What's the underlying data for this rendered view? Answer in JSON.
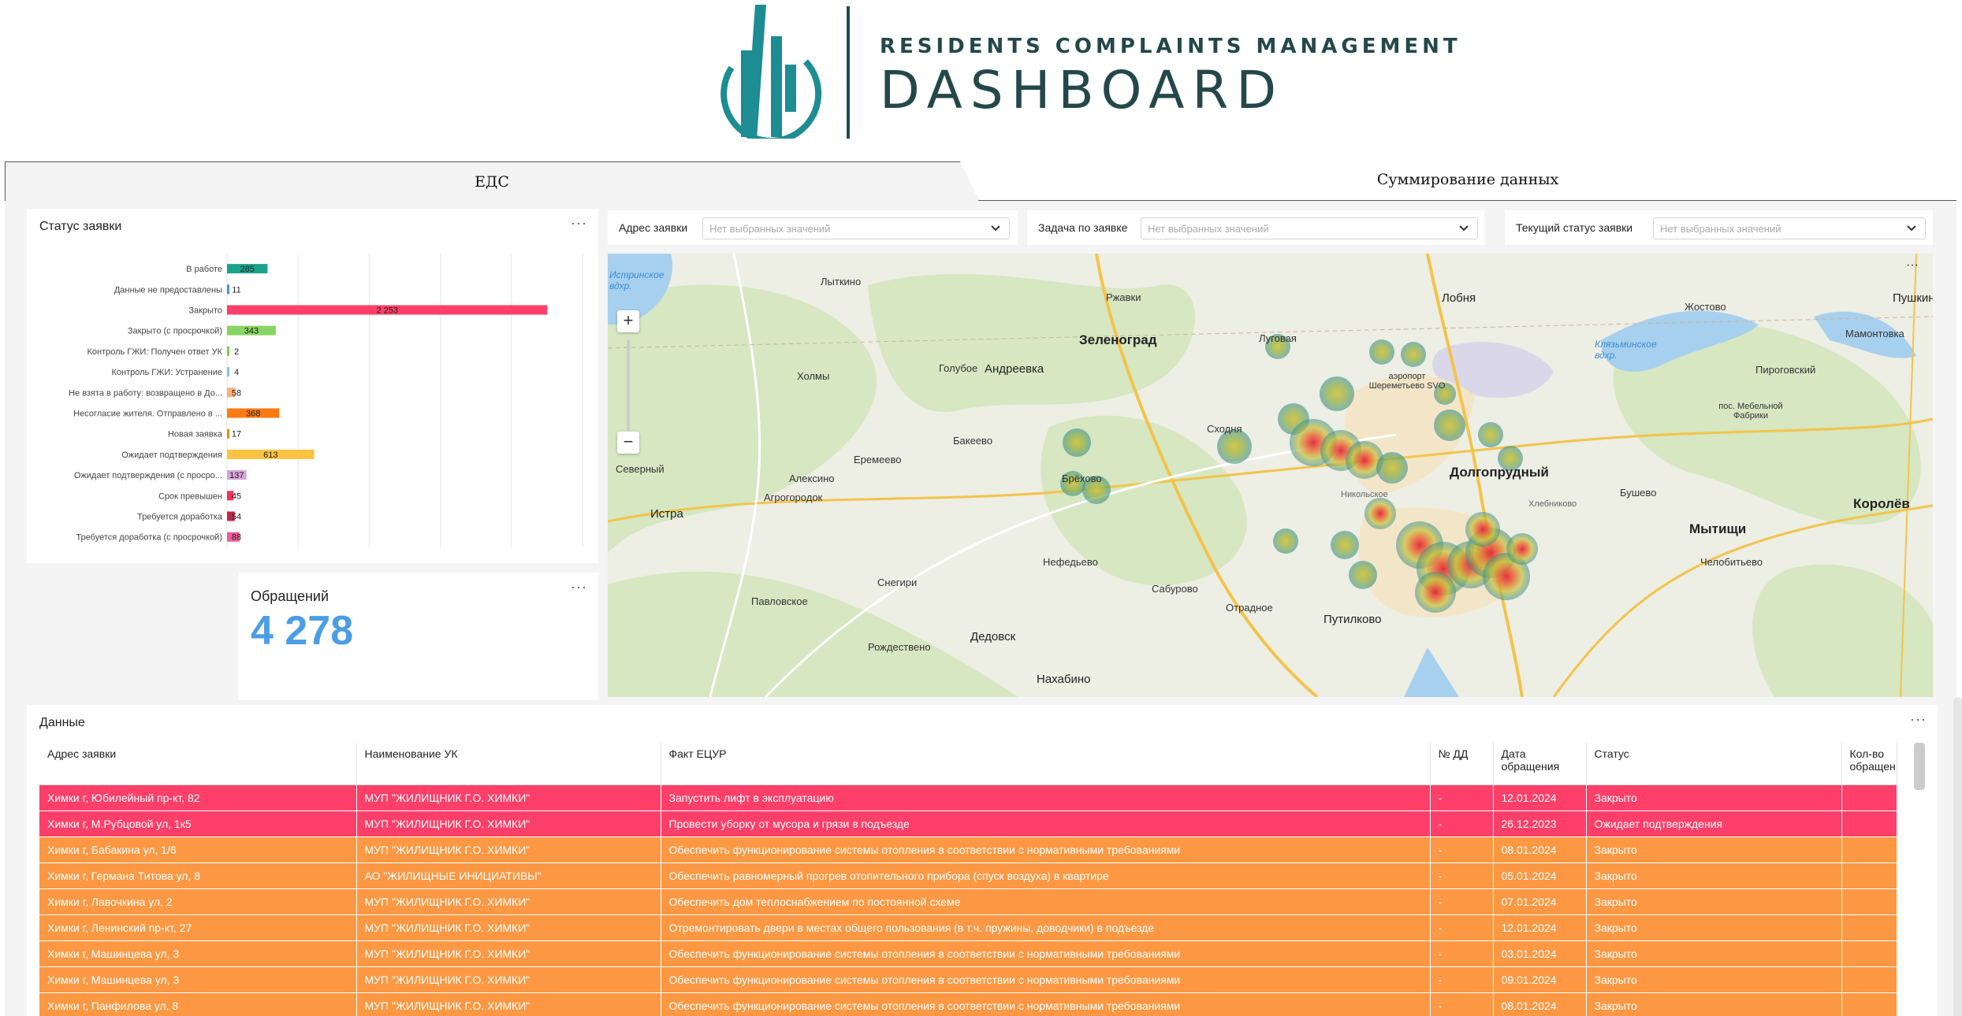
{
  "brand": {
    "line1": "RESIDENTS COMPLAINTS MANAGEMENT",
    "line2": "DASHBOARD",
    "colors": {
      "teal": "#1d8c93",
      "dark": "#24484a"
    }
  },
  "tabs": [
    {
      "label": "ЕДС",
      "active": true
    },
    {
      "label": "Суммирование данных",
      "active": false
    }
  ],
  "filters": [
    {
      "label": "Адрес заявки",
      "placeholder": "Нет выбранных значений"
    },
    {
      "label": "Задача по заявке",
      "placeholder": "Нет выбранных значений"
    },
    {
      "label": "Текущий статус заявки",
      "placeholder": "Нет выбранных значений"
    }
  ],
  "status_panel": {
    "title": "Статус заявки",
    "menu": "···"
  },
  "chart_data": {
    "type": "bar",
    "orientation": "horizontal",
    "categories": [
      "В работе",
      "Данные не предоставлены",
      "Закрыто",
      "Закрыто (с просрочкой)",
      "Контроль ГЖИ: Получен ответ УК",
      "Контроль ГЖИ: Устранение",
      "Не взята в работу: возвращено в До...",
      "Несогласие жителя. Отправлено в ...",
      "Новая заявка",
      "Ожидает подтверждения",
      "Ожидает подтверждения (с просро...",
      "Срок превышен",
      "Требуется доработка",
      "Требуется доработка (с просрочкой)"
    ],
    "values": [
      285,
      11,
      2253,
      343,
      2,
      4,
      58,
      368,
      17,
      613,
      137,
      45,
      54,
      88
    ],
    "value_labels": [
      "285",
      "11",
      "2 253",
      "343",
      "2",
      "4",
      "58",
      "368",
      "17",
      "613",
      "137",
      "45",
      "54",
      "88"
    ],
    "colors": [
      "#1ba38a",
      "#4a90e2",
      "#fd3f69",
      "#86d562",
      "#7ed04c",
      "#76c9ea",
      "#fdb17a",
      "#fc7a12",
      "#d4940f",
      "#fcc342",
      "#d8a3da",
      "#f22e5c",
      "#c4254a",
      "#ee5b9a"
    ],
    "grid": true
  },
  "kpi": {
    "title": "Обращений",
    "value": "4 278",
    "menu": "···"
  },
  "map": {
    "menu": "···",
    "zoom_in": "+",
    "zoom_out": "−",
    "places": [
      "Пушкино",
      "Лобня",
      "Зеленоград",
      "Андреевка",
      "Долгопрудный",
      "Мытищи",
      "Королёв",
      "Истра",
      "Путилково",
      "Дедовск",
      "Нахабино",
      "Ржавки",
      "Жостово",
      "Мамонтовка",
      "Пироговский",
      "Голубое",
      "Бакеево",
      "Еремеево",
      "Алексино",
      "Агрогородок",
      "Холмы",
      "Лыткино",
      "Северный",
      "Павловское",
      "Снегири",
      "Нефедьево",
      "Сабурово",
      "Отрадное",
      "Рождествено",
      "Бушево",
      "Челобитьево",
      "Брёхово",
      "Луговая",
      "аэропорт Шереметьево SVO",
      "пос. Мебельной Фабрики",
      "Клязьминское вдхр.",
      "Истринское вдхр.",
      "Никольское",
      "Сходня",
      "Хлебниково"
    ]
  },
  "table": {
    "title": "Данные",
    "menu": "···",
    "columns": [
      "Адрес заявки",
      "Наименование УК",
      "Факт ЕЦУР",
      "№ ДД",
      "Дата обращения",
      "Статус",
      "Кол-во обращен"
    ],
    "rows": [
      {
        "color": "red",
        "cells": [
          "Химки г, Юбилейный пр-кт, 82",
          "МУП \"ЖИЛИЩНИК Г.О. ХИМКИ\"",
          "Запустить лифт в эксплуатацию",
          "-",
          "12.01.2024",
          "Закрыто",
          ""
        ]
      },
      {
        "color": "red",
        "cells": [
          "Химки г, М.Рубцовой ул, 1к5",
          "МУП \"ЖИЛИЩНИК Г.О. ХИМКИ\"",
          "Провести уборку от мусора и грязи в подъезде",
          "-",
          "26.12.2023",
          "Ожидает подтверждения",
          ""
        ]
      },
      {
        "color": "orange",
        "cells": [
          "Химки г, Бабакина ул, 1/6",
          "МУП \"ЖИЛИЩНИК Г.О. ХИМКИ\"",
          "Обеспечить функционирование системы отопления в соответствии с нормативными требованиями",
          "-",
          "08.01.2024",
          "Закрыто",
          ""
        ]
      },
      {
        "color": "orange",
        "cells": [
          "Химки г, Германа Титова ул, 8",
          "АО \"ЖИЛИЩНЫЕ ИНИЦИАТИВЫ\"",
          "Обеспечить равномерный прогрев отопительного прибора (спуск воздуха) в квартире",
          "-",
          "05.01.2024",
          "Закрыто",
          ""
        ]
      },
      {
        "color": "orange",
        "cells": [
          "Химки г, Лавочкина ул, 2",
          "МУП \"ЖИЛИЩНИК Г.О. ХИМКИ\"",
          "Обеспечить дом теплоснабжением по постоянной схеме",
          "-",
          "07.01.2024",
          "Закрыто",
          ""
        ]
      },
      {
        "color": "orange",
        "cells": [
          "Химки г, Ленинский пр-кт, 27",
          "МУП \"ЖИЛИЩНИК Г.О. ХИМКИ\"",
          "Отремонтировать двери в местах общего пользования (в т.ч. пружины, доводчики) в подъезде",
          "-",
          "12.01.2024",
          "Закрыто",
          ""
        ]
      },
      {
        "color": "orange",
        "cells": [
          "Химки г, Машинцева ул, 3",
          "МУП \"ЖИЛИЩНИК Г.О. ХИМКИ\"",
          "Обеспечить функционирование системы отопления в соответствии с нормативными требованиями",
          "-",
          "03.01.2024",
          "Закрыто",
          ""
        ]
      },
      {
        "color": "orange",
        "cells": [
          "Химки г, Машинцева ул, 3",
          "МУП \"ЖИЛИЩНИК Г.О. ХИМКИ\"",
          "Обеспечить функционирование системы отопления в соответствии с нормативными требованиями",
          "-",
          "09.01.2024",
          "Закрыто",
          ""
        ]
      },
      {
        "color": "orange",
        "cells": [
          "Химки г, Панфилова ул, 8",
          "МУП \"ЖИЛИЩНИК Г.О. ХИМКИ\"",
          "Обеспечить функционирование системы отопления в соответствии с нормативными требованиями",
          "-",
          "08.01.2024",
          "Закрыто",
          ""
        ]
      }
    ]
  }
}
